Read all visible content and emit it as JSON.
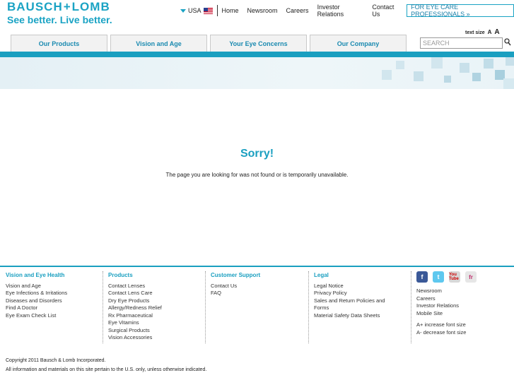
{
  "header": {
    "logo_left": "BAUSCH",
    "logo_plus": "+",
    "logo_right": "LOMB",
    "tagline": "See better. Live better.",
    "country": "USA",
    "top_links": [
      "Home",
      "Newsroom",
      "Careers",
      "Investor Relations",
      "Contact Us"
    ],
    "professionals": "FOR EYE CARE PROFESSIONALS »",
    "text_size_label": "text size",
    "text_size_small": "A",
    "text_size_large": "A",
    "search_placeholder": "SEARCH"
  },
  "tabs": [
    "Our Products",
    "Vision and Age",
    "Your Eye Concerns",
    "Our Company"
  ],
  "main": {
    "heading": "Sorry!",
    "message": "The page you are looking for was not found or is temporarily unavailable."
  },
  "footer": {
    "columns": [
      {
        "title": "Vision and Eye Health",
        "items": [
          "Vision and Age",
          "Eye Infections & Irritations",
          "Diseases and Disorders",
          "Find A Doctor",
          "Eye Exam Check List"
        ]
      },
      {
        "title": "Products",
        "items": [
          "Contact Lenses",
          "Contact Lens Care",
          "Dry Eye Products",
          "Allergy/Redness Relief",
          "Rx Pharmaceutical",
          "Eye Vitamins",
          "Surgical Products",
          "Vision Accessories"
        ]
      },
      {
        "title": "Customer Support",
        "items": [
          "Contact Us",
          "FAQ"
        ]
      },
      {
        "title": "Legal",
        "items": [
          "Legal Notice",
          "Privacy Policy",
          "Sales and Return Policies and",
          "Forms",
          "Material Safety Data Sheets"
        ]
      }
    ],
    "social": [
      "f",
      "t",
      "You Tube",
      "fr"
    ],
    "extra_links": [
      "Newsroom",
      "Careers",
      "Investor Relations",
      "Mobile Site"
    ],
    "font_links": [
      "A+ increase font size",
      "A- decrease font size"
    ],
    "copyright": "Copyright 2011 Bausch & Lomb Incorporated.",
    "note": "All information and materials on this site pertain to the U.S. only, unless otherwise indicated."
  },
  "colors": {
    "accent": "#1a9fc0",
    "facebook": "#3b5998",
    "twitter": "#5ec8ef"
  }
}
